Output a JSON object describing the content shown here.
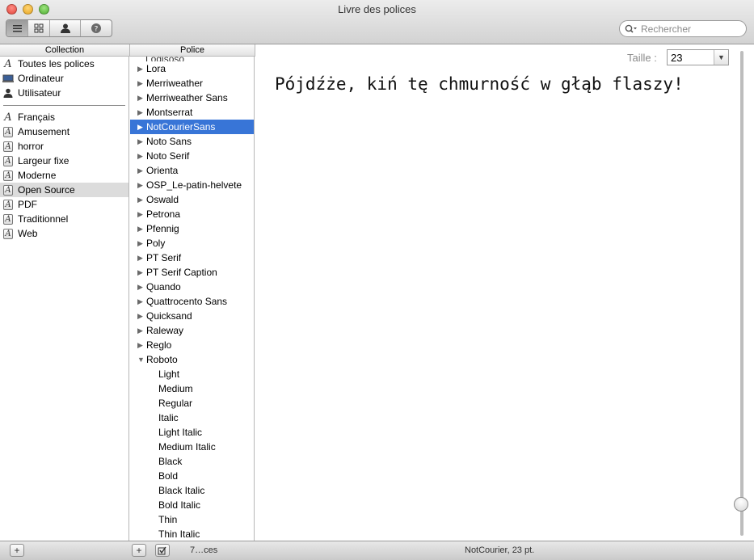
{
  "window": {
    "title": "Livre des polices"
  },
  "search": {
    "placeholder": "Rechercher"
  },
  "columns": {
    "collection": "Collection",
    "police": "Police"
  },
  "collections_top": [
    {
      "label": "Toutes les polices",
      "icon": "font-A-icon"
    },
    {
      "label": "Ordinateur",
      "icon": "computer-icon"
    },
    {
      "label": "Utilisateur",
      "icon": "user-icon"
    }
  ],
  "collections_bottom": [
    {
      "label": "Français",
      "icon": "font-A-icon"
    },
    {
      "label": "Amusement",
      "icon": "collection-icon"
    },
    {
      "label": "horror",
      "icon": "collection-icon"
    },
    {
      "label": "Largeur fixe",
      "icon": "collection-icon"
    },
    {
      "label": "Moderne",
      "icon": "collection-icon"
    },
    {
      "label": "Open Source",
      "icon": "collection-icon",
      "selected": true
    },
    {
      "label": "PDF",
      "icon": "collection-icon"
    },
    {
      "label": "Traditionnel",
      "icon": "collection-icon"
    },
    {
      "label": "Web",
      "icon": "collection-icon"
    }
  ],
  "fonts_clipped": "Logisoso",
  "fonts": [
    {
      "label": "Lora"
    },
    {
      "label": "Merriweather"
    },
    {
      "label": "Merriweather Sans"
    },
    {
      "label": "Montserrat"
    },
    {
      "label": "NotCourierSans",
      "selected": true
    },
    {
      "label": "Noto Sans"
    },
    {
      "label": "Noto Serif"
    },
    {
      "label": "Orienta"
    },
    {
      "label": "OSP_Le-patin-helvete"
    },
    {
      "label": "Oswald"
    },
    {
      "label": "Petrona"
    },
    {
      "label": "Pfennig"
    },
    {
      "label": "Poly"
    },
    {
      "label": "PT Serif"
    },
    {
      "label": "PT Serif Caption"
    },
    {
      "label": "Quando"
    },
    {
      "label": "Quattrocento Sans"
    },
    {
      "label": "Quicksand"
    },
    {
      "label": "Raleway"
    },
    {
      "label": "Reglo"
    },
    {
      "label": "Roboto",
      "expanded": true
    }
  ],
  "roboto_faces": [
    "Light",
    "Medium",
    "Regular",
    "Italic",
    "Light Italic",
    "Medium Italic",
    "Black",
    "Bold",
    "Black Italic",
    "Bold Italic",
    "Thin",
    "Thin Italic"
  ],
  "preview": {
    "size_label": "Taille :",
    "size_value": "23",
    "text": "Pójdźże, kiń tę chmurność w głąb flaszy!",
    "slider_level": 0.92
  },
  "status": {
    "left_text": "7…ces",
    "center_text": "NotCourier, 23 pt."
  },
  "colors": {
    "selection": "#3875d7",
    "inactive_selection": "#dcdcdc"
  }
}
